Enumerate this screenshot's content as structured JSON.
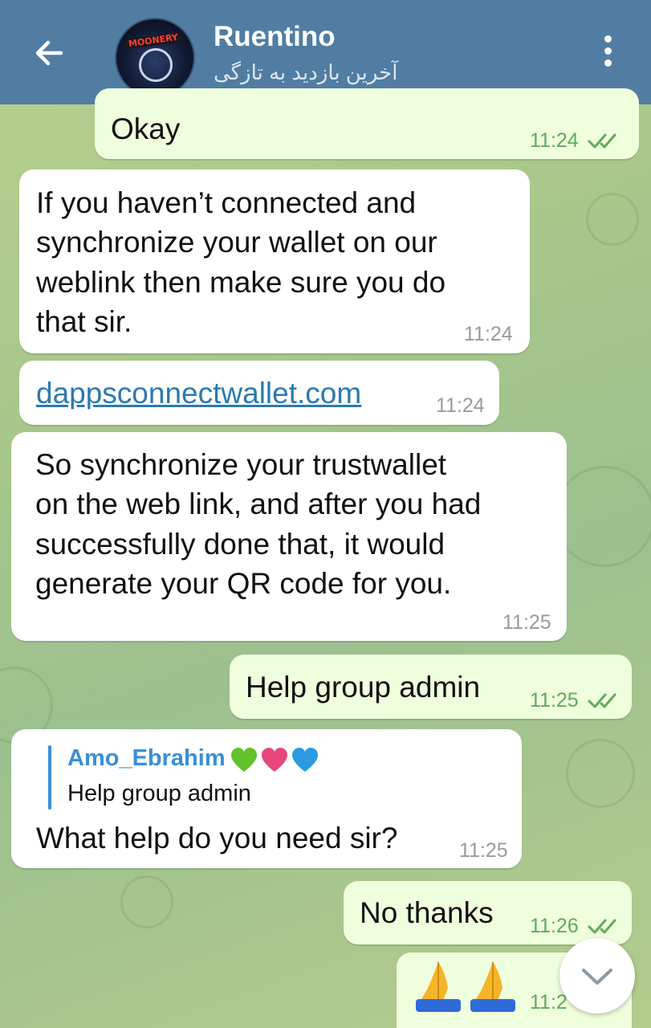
{
  "header": {
    "name": "Ruentino",
    "status": "آخرین بازدید به تازگی",
    "avatar_text": "MOONERY"
  },
  "messages": [
    {
      "text": "Okay",
      "time": "11:24"
    },
    {
      "text_lines": [
        "If you haven’t connected and",
        "synchronize your wallet on our",
        "weblink then make sure you do",
        "that sir."
      ],
      "time": "11:24"
    },
    {
      "text": "dappsconnectwallet.com",
      "time": "11:24"
    },
    {
      "text_lines": [
        "So synchronize your trustwallet",
        "on the web link, and after you had",
        "successfully done that, it would",
        "generate your QR code for you."
      ],
      "time": "11:25"
    },
    {
      "text": "Help group admin",
      "time": "11:25"
    },
    {
      "reply_name": "Amo_Ebrahim",
      "reply_text": "Help group admin",
      "text": "What help do you need sir?",
      "time": "11:25"
    },
    {
      "text": "No thanks",
      "time": "11:26"
    },
    {
      "text": "🙏🙏",
      "time": "11:2"
    }
  ],
  "colors": {
    "header": "#517da2",
    "incoming_bubble": "#ffffff",
    "outgoing_bubble": "#effedd",
    "link": "#2a7ab0",
    "read_check": "#5faa5a"
  }
}
